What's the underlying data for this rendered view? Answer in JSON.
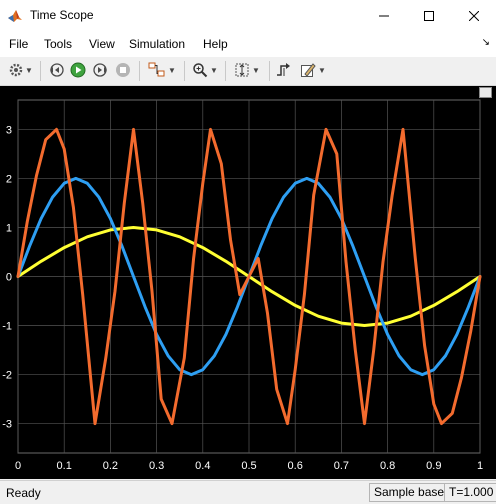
{
  "window": {
    "title": "Time Scope"
  },
  "menu": [
    "File",
    "Tools",
    "View",
    "Simulation",
    "Help"
  ],
  "status": {
    "left": "Ready",
    "mode": "Sample based",
    "time": "T=1.000"
  },
  "chart_data": {
    "type": "line",
    "xlim": [
      0,
      1
    ],
    "ylim": [
      -3.6,
      3.6
    ],
    "x_ticks": [
      "0",
      "0.1",
      "0.2",
      "0.3",
      "0.4",
      "0.5",
      "0.6",
      "0.7",
      "0.8",
      "0.9",
      "1"
    ],
    "y_ticks": [
      "3",
      "2",
      "1",
      "0",
      "-1",
      "-2",
      "-3"
    ],
    "grid": true,
    "background": "#000000",
    "series": [
      {
        "color": "#ffff33",
        "x": [
          0,
          0.05,
          0.1,
          0.15,
          0.2,
          0.25,
          0.3,
          0.35,
          0.4,
          0.45,
          0.5,
          0.55,
          0.6,
          0.65,
          0.7,
          0.75,
          0.8,
          0.85,
          0.9,
          0.95,
          1.0
        ],
        "y": [
          0,
          0.31,
          0.59,
          0.81,
          0.95,
          1.0,
          0.95,
          0.81,
          0.59,
          0.31,
          0,
          -0.31,
          -0.59,
          -0.81,
          -0.95,
          -1.0,
          -0.95,
          -0.81,
          -0.59,
          -0.31,
          0
        ]
      },
      {
        "color": "#2e9ff3",
        "x": [
          0,
          0.025,
          0.05,
          0.075,
          0.1,
          0.125,
          0.15,
          0.175,
          0.2,
          0.225,
          0.25,
          0.275,
          0.3,
          0.325,
          0.35,
          0.375,
          0.4,
          0.425,
          0.45,
          0.475,
          0.5,
          0.525,
          0.55,
          0.575,
          0.6,
          0.625,
          0.65,
          0.675,
          0.7,
          0.725,
          0.75,
          0.775,
          0.8,
          0.825,
          0.85,
          0.875,
          0.9,
          0.925,
          0.95,
          0.975,
          1.0
        ],
        "y": [
          0,
          0.62,
          1.18,
          1.62,
          1.9,
          2.0,
          1.9,
          1.62,
          1.18,
          0.62,
          0,
          -0.62,
          -1.18,
          -1.62,
          -1.9,
          -2.0,
          -1.9,
          -1.62,
          -1.18,
          -0.62,
          0,
          0.62,
          1.18,
          1.62,
          1.9,
          2.0,
          1.9,
          1.62,
          1.18,
          0.62,
          0,
          -0.62,
          -1.18,
          -1.62,
          -1.9,
          -2.0,
          -1.9,
          -1.62,
          -1.18,
          -0.62,
          0
        ]
      },
      {
        "color": "#f36b2e",
        "x": [
          0,
          0.02,
          0.04,
          0.06,
          0.0833,
          0.1,
          0.12,
          0.14,
          0.1667,
          0.19,
          0.21,
          0.23,
          0.25,
          0.27,
          0.29,
          0.31,
          0.3333,
          0.36,
          0.38,
          0.4,
          0.4167,
          0.44,
          0.46,
          0.48,
          0.5,
          0.52,
          0.54,
          0.56,
          0.5833,
          0.6,
          0.62,
          0.64,
          0.6667,
          0.69,
          0.71,
          0.73,
          0.75,
          0.77,
          0.79,
          0.81,
          0.8333,
          0.86,
          0.88,
          0.9,
          0.9167,
          0.94,
          0.96,
          0.98,
          1.0
        ],
        "y": [
          0,
          1.11,
          2.06,
          2.79,
          3.0,
          2.6,
          1.41,
          -0.37,
          -3.0,
          -1.66,
          -0.3,
          1.5,
          3.0,
          1.5,
          -0.3,
          -2.5,
          -3.0,
          -1.66,
          0.37,
          1.9,
          3.0,
          2.3,
          0.75,
          -0.37,
          0,
          0.37,
          -0.75,
          -2.3,
          -3.0,
          -1.9,
          -0.37,
          1.66,
          3.0,
          2.5,
          0.3,
          -1.5,
          -3.0,
          -1.5,
          0.3,
          1.66,
          3.0,
          0.37,
          -1.41,
          -2.6,
          -3.0,
          -2.79,
          -2.06,
          -1.11,
          0
        ]
      }
    ]
  }
}
